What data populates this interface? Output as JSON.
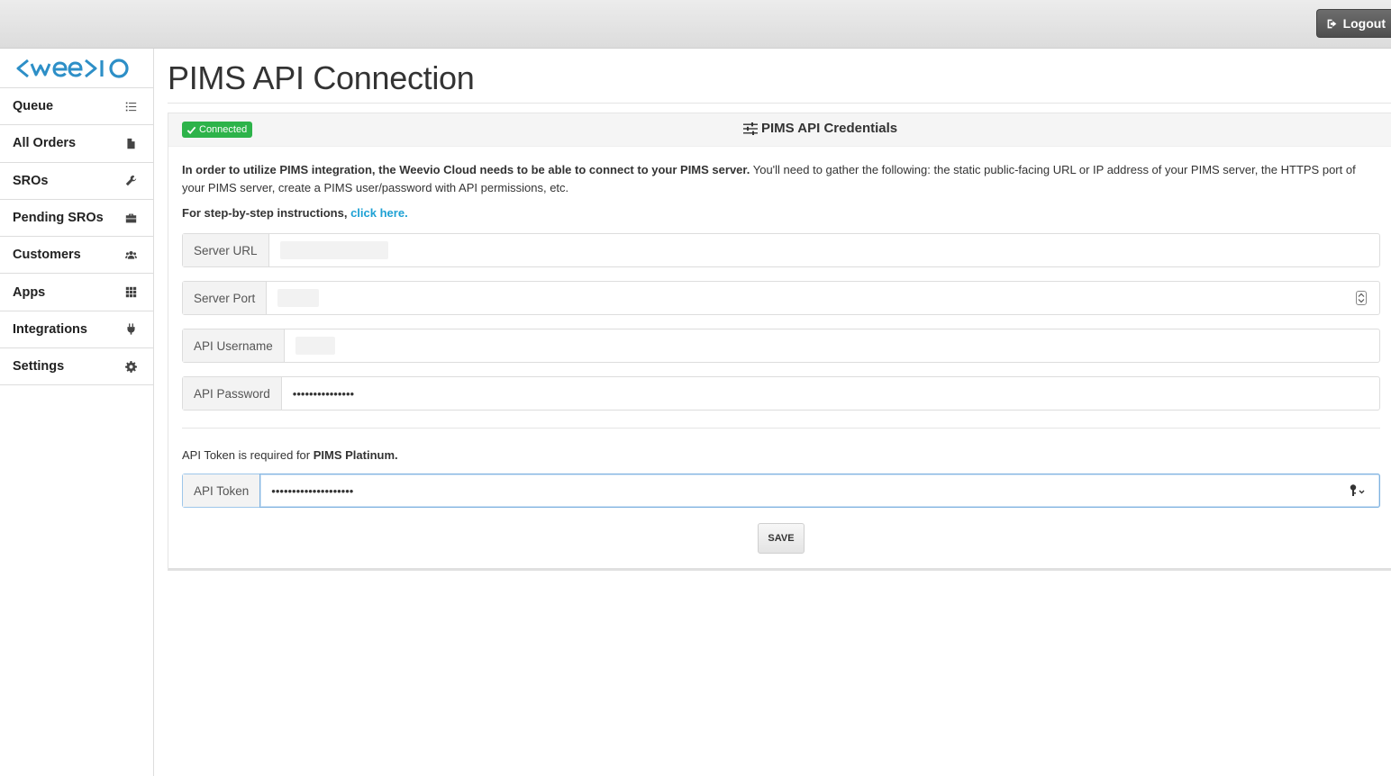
{
  "header": {
    "logout_label": "Logout"
  },
  "logo": {
    "text": "<wee>io",
    "color": "#2d8fc7"
  },
  "sidebar": {
    "items": [
      {
        "label": "Queue",
        "icon": "list-icon"
      },
      {
        "label": "All Orders",
        "icon": "file-icon"
      },
      {
        "label": "SROs",
        "icon": "wrench-icon"
      },
      {
        "label": "Pending SROs",
        "icon": "briefcase-icon"
      },
      {
        "label": "Customers",
        "icon": "users-icon"
      },
      {
        "label": "Apps",
        "icon": "grid-icon"
      },
      {
        "label": "Integrations",
        "icon": "plug-icon"
      },
      {
        "label": "Settings",
        "icon": "gear-icon"
      }
    ]
  },
  "page": {
    "title": "PIMS API Connection"
  },
  "panel": {
    "status_badge": "Connected",
    "status_color": "#2db34a",
    "title": "PIMS API Credentials",
    "intro_bold": "In order to utilize PIMS integration, the Weevio Cloud needs to be able to connect to your PIMS server.",
    "intro_rest": " You'll need to gather the following: the static public-facing URL or IP address of your PIMS server, the HTTPS port of your PIMS server, create a PIMS user/password with API permissions, etc.",
    "instructions_prefix": "For step-by-step instructions, ",
    "instructions_link": "click here.",
    "link_color": "#1ea1d4"
  },
  "form": {
    "server_url": {
      "label": "Server URL",
      "value": ""
    },
    "server_port": {
      "label": "Server Port",
      "value": ""
    },
    "api_username": {
      "label": "API Username",
      "value": ""
    },
    "api_password": {
      "label": "API Password",
      "value": "•••••••••••••••"
    },
    "token_note_prefix": "API Token is required for ",
    "token_note_bold": "PIMS Platinum.",
    "api_token": {
      "label": "API Token",
      "value": "••••••••••••••••••••"
    },
    "save_label": "SAVE"
  }
}
